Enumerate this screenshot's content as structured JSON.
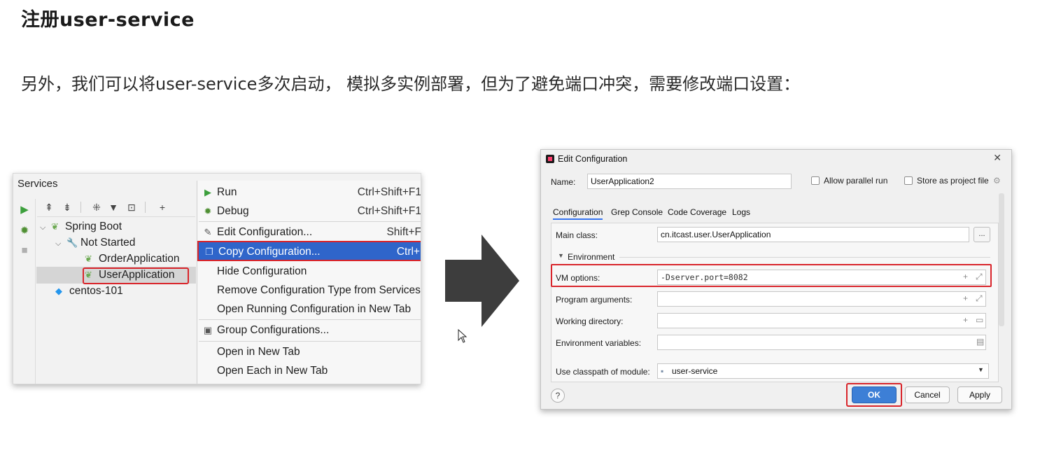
{
  "heading": "注册user-service",
  "intro": "另外，我们可以将user-service多次启动， 模拟多实例部署，但为了避免端口冲突，需要修改端口设置：",
  "services_panel": {
    "title": "Services",
    "tree": {
      "spring_boot": "Spring Boot",
      "not_started": "Not Started",
      "order_app": "OrderApplication",
      "user_app": "UserApplication",
      "centos": "centos-101"
    },
    "menu": [
      {
        "label": "Run",
        "shortcut": "Ctrl+Shift+F1"
      },
      {
        "label": "Debug",
        "shortcut": "Ctrl+Shift+F1"
      },
      {
        "label": "Edit Configuration...",
        "shortcut": "Shift+F"
      },
      {
        "label": "Copy Configuration...",
        "shortcut": "Ctrl+"
      },
      {
        "label": "Hide Configuration",
        "shortcut": ""
      },
      {
        "label": "Remove Configuration Type from Services",
        "shortcut": ""
      },
      {
        "label": "Open Running Configuration in New Tab",
        "shortcut": ""
      },
      {
        "label": "Group Configurations...",
        "shortcut": ""
      },
      {
        "label": "Open in New Tab",
        "shortcut": ""
      },
      {
        "label": "Open Each in New Tab",
        "shortcut": ""
      }
    ]
  },
  "dialog": {
    "title": "Edit Configuration",
    "name_label": "Name:",
    "name_value": "UserApplication2",
    "allow_parallel": "Allow parallel run",
    "store_project": "Store as project file",
    "tabs": [
      "Configuration",
      "Grep Console",
      "Code Coverage",
      "Logs"
    ],
    "main_class_label": "Main class:",
    "main_class_value": "cn.itcast.user.UserApplication",
    "environment_label": "Environment",
    "vm_options_label": "VM options:",
    "vm_options_value": "-Dserver.port=8082",
    "program_args_label": "Program arguments:",
    "working_dir_label": "Working directory:",
    "env_vars_label": "Environment variables:",
    "classpath_label": "Use classpath of module:",
    "classpath_value": "user-service",
    "ellipsis": "...",
    "help": "?",
    "ok": "OK",
    "cancel": "Cancel",
    "apply": "Apply"
  },
  "colors": {
    "highlight_red": "#d9252b",
    "selection_blue": "#2f65ca",
    "arrow_gray": "#3d3d3d"
  }
}
